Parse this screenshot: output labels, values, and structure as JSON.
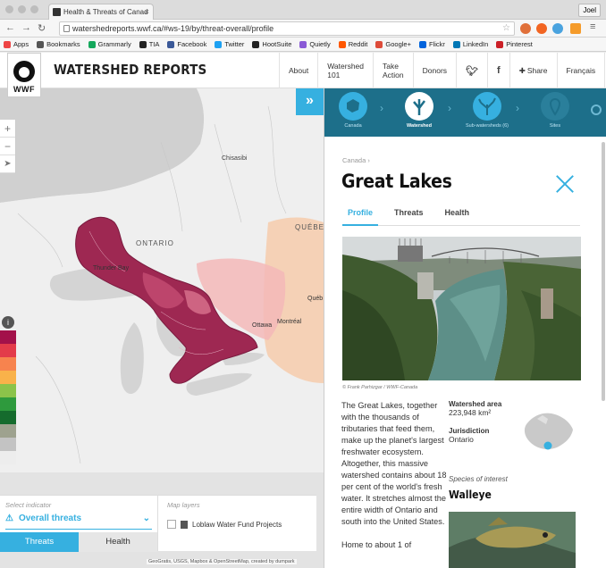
{
  "browser": {
    "tab_title": "Health & Threats of Canad",
    "user": "Joel",
    "url": "watershedreports.wwf.ca/#ws-19/by/threat-overall/profile",
    "bookmarks": [
      {
        "label": "Apps",
        "color": "#e44"
      },
      {
        "label": "Bookmarks",
        "color": "#555"
      },
      {
        "label": "Grammarly",
        "color": "#15a85c"
      },
      {
        "label": "TIA",
        "color": "#222"
      },
      {
        "label": "Facebook",
        "color": "#3b5998"
      },
      {
        "label": "Twitter",
        "color": "#1da1f2"
      },
      {
        "label": "HootSuite",
        "color": "#222"
      },
      {
        "label": "Quietly",
        "color": "#8a5ad6"
      },
      {
        "label": "Reddit",
        "color": "#ff5700"
      },
      {
        "label": "Google+",
        "color": "#dd4b39"
      },
      {
        "label": "Flickr",
        "color": "#0063dc"
      },
      {
        "label": "LinkedIn",
        "color": "#0077b5"
      },
      {
        "label": "Pinterest",
        "color": "#cb2027"
      }
    ]
  },
  "header": {
    "logo_text": "WWF",
    "site_title": "WATERSHED REPORTS",
    "nav": [
      "About",
      "Watershed 101",
      "Take Action",
      "Donors"
    ],
    "share_label": "Share",
    "lang_label": "Français",
    "help_label": "?"
  },
  "map": {
    "labels": {
      "chisasibi": "Chisasibi",
      "ontario": "ONTARIO",
      "quebec": "QUÉBEC",
      "thunder_bay": "Thunder Bay",
      "ottawa": "Ottawa",
      "montreal": "Montréal",
      "queb": "Québ"
    },
    "zoom_in": "+",
    "zoom_out": "−",
    "expand_label": "»",
    "legend_colors": [
      "#a3114a",
      "#e33b4a",
      "#f7834e",
      "#f9b24a",
      "#8bc34a",
      "#2e9a3d",
      "#156b2d",
      "#9ea28f",
      "#c3c3c3",
      "#ededed"
    ],
    "attribution": "GeoGratis, USGS, Mapbox & OpenStreetMap, created by dumpark"
  },
  "indicator": {
    "label": "Select indicator",
    "value": "Overall threats",
    "tabs": [
      "Threats",
      "Health"
    ]
  },
  "layers": {
    "label": "Map layers",
    "item": "Loblaw Water Fund Projects"
  },
  "sidebar": {
    "steps": [
      "Canada",
      "Watershed",
      "Sub-watersheds (6)",
      "Sites"
    ],
    "breadcrumb": "Canada ›",
    "title": "Great Lakes",
    "tabs": [
      "Profile",
      "Threats",
      "Health"
    ],
    "photo_credit": "© Frank Parhizgar / WWF-Canada",
    "body": "The Great Lakes, together with the thousands of tributaries that feed them, make up the planet's largest freshwater ecosystem. Altogether, this massive watershed contains about 18 per cent of the world's fresh water. It stretches almost the entire width of Ontario and south into the United States.",
    "body_tail": "Home to about 1 of",
    "area_label": "Watershed area",
    "area_value": "223,948 km²",
    "jurisdiction_label": "Jurisdiction",
    "jurisdiction_value": "Ontario",
    "species_label": "Species of interest",
    "species_name": "Walleye"
  },
  "accent_color": "#36b0e0"
}
